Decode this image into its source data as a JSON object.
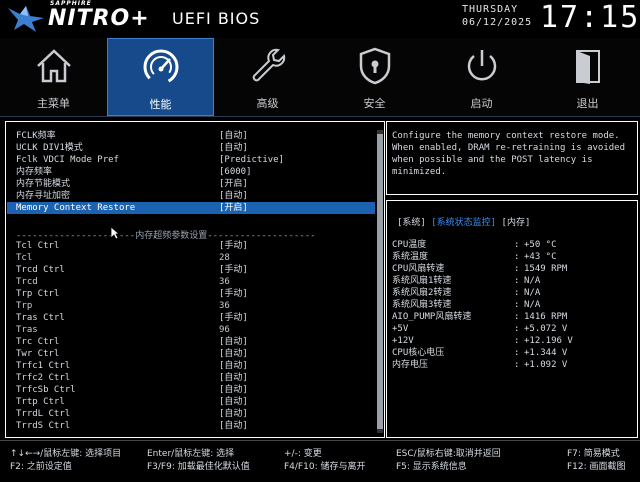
{
  "header": {
    "brand_sub": "SAPPHIRE",
    "brand": "NITRO+",
    "title": "UEFI BIOS",
    "day": "THURSDAY",
    "date": "06/12/2025",
    "time": "17:15"
  },
  "nav": [
    {
      "label": "主菜单",
      "icon": "home-icon"
    },
    {
      "label": "性能",
      "icon": "speedometer-icon"
    },
    {
      "label": "高级",
      "icon": "wrench-icon"
    },
    {
      "label": "安全",
      "icon": "shield-lock-icon"
    },
    {
      "label": "启动",
      "icon": "power-icon"
    },
    {
      "label": "退出",
      "icon": "exit-door-icon"
    }
  ],
  "settings": [
    {
      "name": "FCLK频率",
      "value": "[自动]"
    },
    {
      "name": "UCLK DIV1模式",
      "value": "[自动]"
    },
    {
      "name": "Fclk VDCI Mode Pref",
      "value": "[Predictive]"
    },
    {
      "name": "内存频率",
      "value": "[6000]"
    },
    {
      "name": "内存节能模式",
      "value": "[开启]"
    },
    {
      "name": "内存寻址加密",
      "value": "[自动]"
    },
    {
      "name": "Memory Context Restore",
      "value": "[开启]"
    }
  ],
  "divider": "----------------------内存超频参数设置--------------------",
  "timings": [
    {
      "name": "Tcl Ctrl",
      "value": "[手动]"
    },
    {
      "name": "Tcl",
      "value": "28"
    },
    {
      "name": "Trcd Ctrl",
      "value": "[手动]"
    },
    {
      "name": "Trcd",
      "value": "36"
    },
    {
      "name": "Trp Ctrl",
      "value": "[手动]"
    },
    {
      "name": "Trp",
      "value": "36"
    },
    {
      "name": "Tras Ctrl",
      "value": "[手动]"
    },
    {
      "name": "Tras",
      "value": "96"
    },
    {
      "name": "Trc Ctrl",
      "value": "[自动]"
    },
    {
      "name": "Twr Ctrl",
      "value": "[自动]"
    },
    {
      "name": "Trfc1 Ctrl",
      "value": "[自动]"
    },
    {
      "name": "Trfc2 Ctrl",
      "value": "[自动]"
    },
    {
      "name": "TrfcSb Ctrl",
      "value": "[自动]"
    },
    {
      "name": "Trtp Ctrl",
      "value": "[自动]"
    },
    {
      "name": "TrrdL Ctrl",
      "value": "[自动]"
    },
    {
      "name": "TrrdS Ctrl",
      "value": "[自动]"
    }
  ],
  "help": "Configure the memory context restore mode. When enabled, DRAM re-retraining is avoided when possible and the POST latency is minimized.",
  "monitor_tabs": {
    "t1": "[系统]",
    "t2": "[系统状态监控]",
    "t3": "[内存]"
  },
  "monitor": [
    {
      "name": "CPU温度",
      "value": "+50 °C"
    },
    {
      "name": "系统温度",
      "value": "+43 °C"
    },
    {
      "name": "CPU风扇转速",
      "value": "1549 RPM"
    },
    {
      "name": "系统风扇1转速",
      "value": "N/A"
    },
    {
      "name": "系统风扇2转速",
      "value": "N/A"
    },
    {
      "name": "系统风扇3转速",
      "value": "N/A"
    },
    {
      "name": "AIO_PUMP风扇转速",
      "value": "1416 RPM"
    },
    {
      "name": "+5V",
      "value": "+5.072 V"
    },
    {
      "name": "+12V",
      "value": "+12.196 V"
    },
    {
      "name": "CPU核心电压",
      "value": "+1.344 V"
    },
    {
      "name": "内存电压",
      "value": "+1.092 V"
    }
  ],
  "footer": {
    "a1": "↑↓←→/鼠标左键: 选择项目",
    "a2": "F2: 之前设定值",
    "b1": "Enter/鼠标左键: 选择",
    "b2": "F3/F9: 加载最佳化默认值",
    "c1": "+/-: 变更",
    "c2": "F4/F10: 储存与离开",
    "d1": "ESC/鼠标右键:取消并返回",
    "d2": "F5: 显示系统信息",
    "e1": "F7: 简易模式",
    "e2": "F12: 画面截图"
  },
  "colors": {
    "accent": "#1b62b0",
    "active_tab": "#174a8a",
    "monitor_tab_active": "#3c8ef0"
  }
}
